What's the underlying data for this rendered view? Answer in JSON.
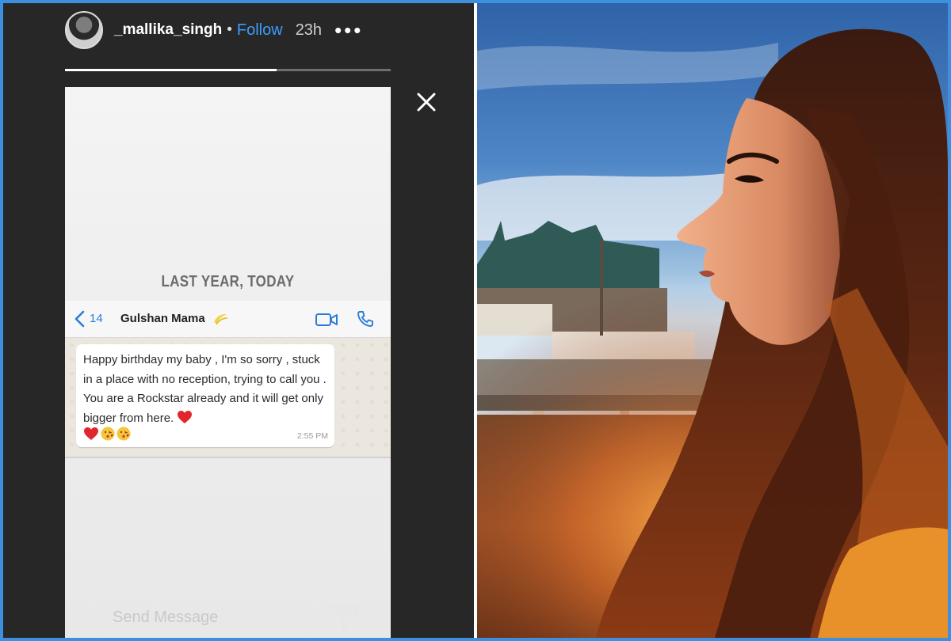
{
  "story": {
    "username": "_mallika_singh",
    "separator": "•",
    "follow_label": "Follow",
    "time_ago": "23h",
    "more_label": "•••",
    "progress": 0.65,
    "memory_label": "LAST YEAR, TODAY",
    "send_placeholder": "Send Message",
    "icons": [
      "avatar",
      "more-options-icon",
      "close-icon",
      "send-icon"
    ]
  },
  "whatsapp": {
    "back_count": "14",
    "contact_name": "Gulshan Mama",
    "message_text": "Happy birthday my baby , I'm so sorry , stuck in a place with no reception, trying to call you . You are a Rockstar already and it will get only bigger from here.",
    "message_time": "2:55 PM",
    "icons": [
      "back-chevron-icon",
      "dizzy-emoji-icon",
      "video-call-icon",
      "phone-call-icon",
      "heart-emoji-icon",
      "kiss-emoji-icon"
    ]
  },
  "colors": {
    "border": "#3d8fe0",
    "story_bg": "#272727",
    "follow": "#3b9cff",
    "whatsapp_blue": "#2b7cd8",
    "heart": "#e0262c"
  }
}
